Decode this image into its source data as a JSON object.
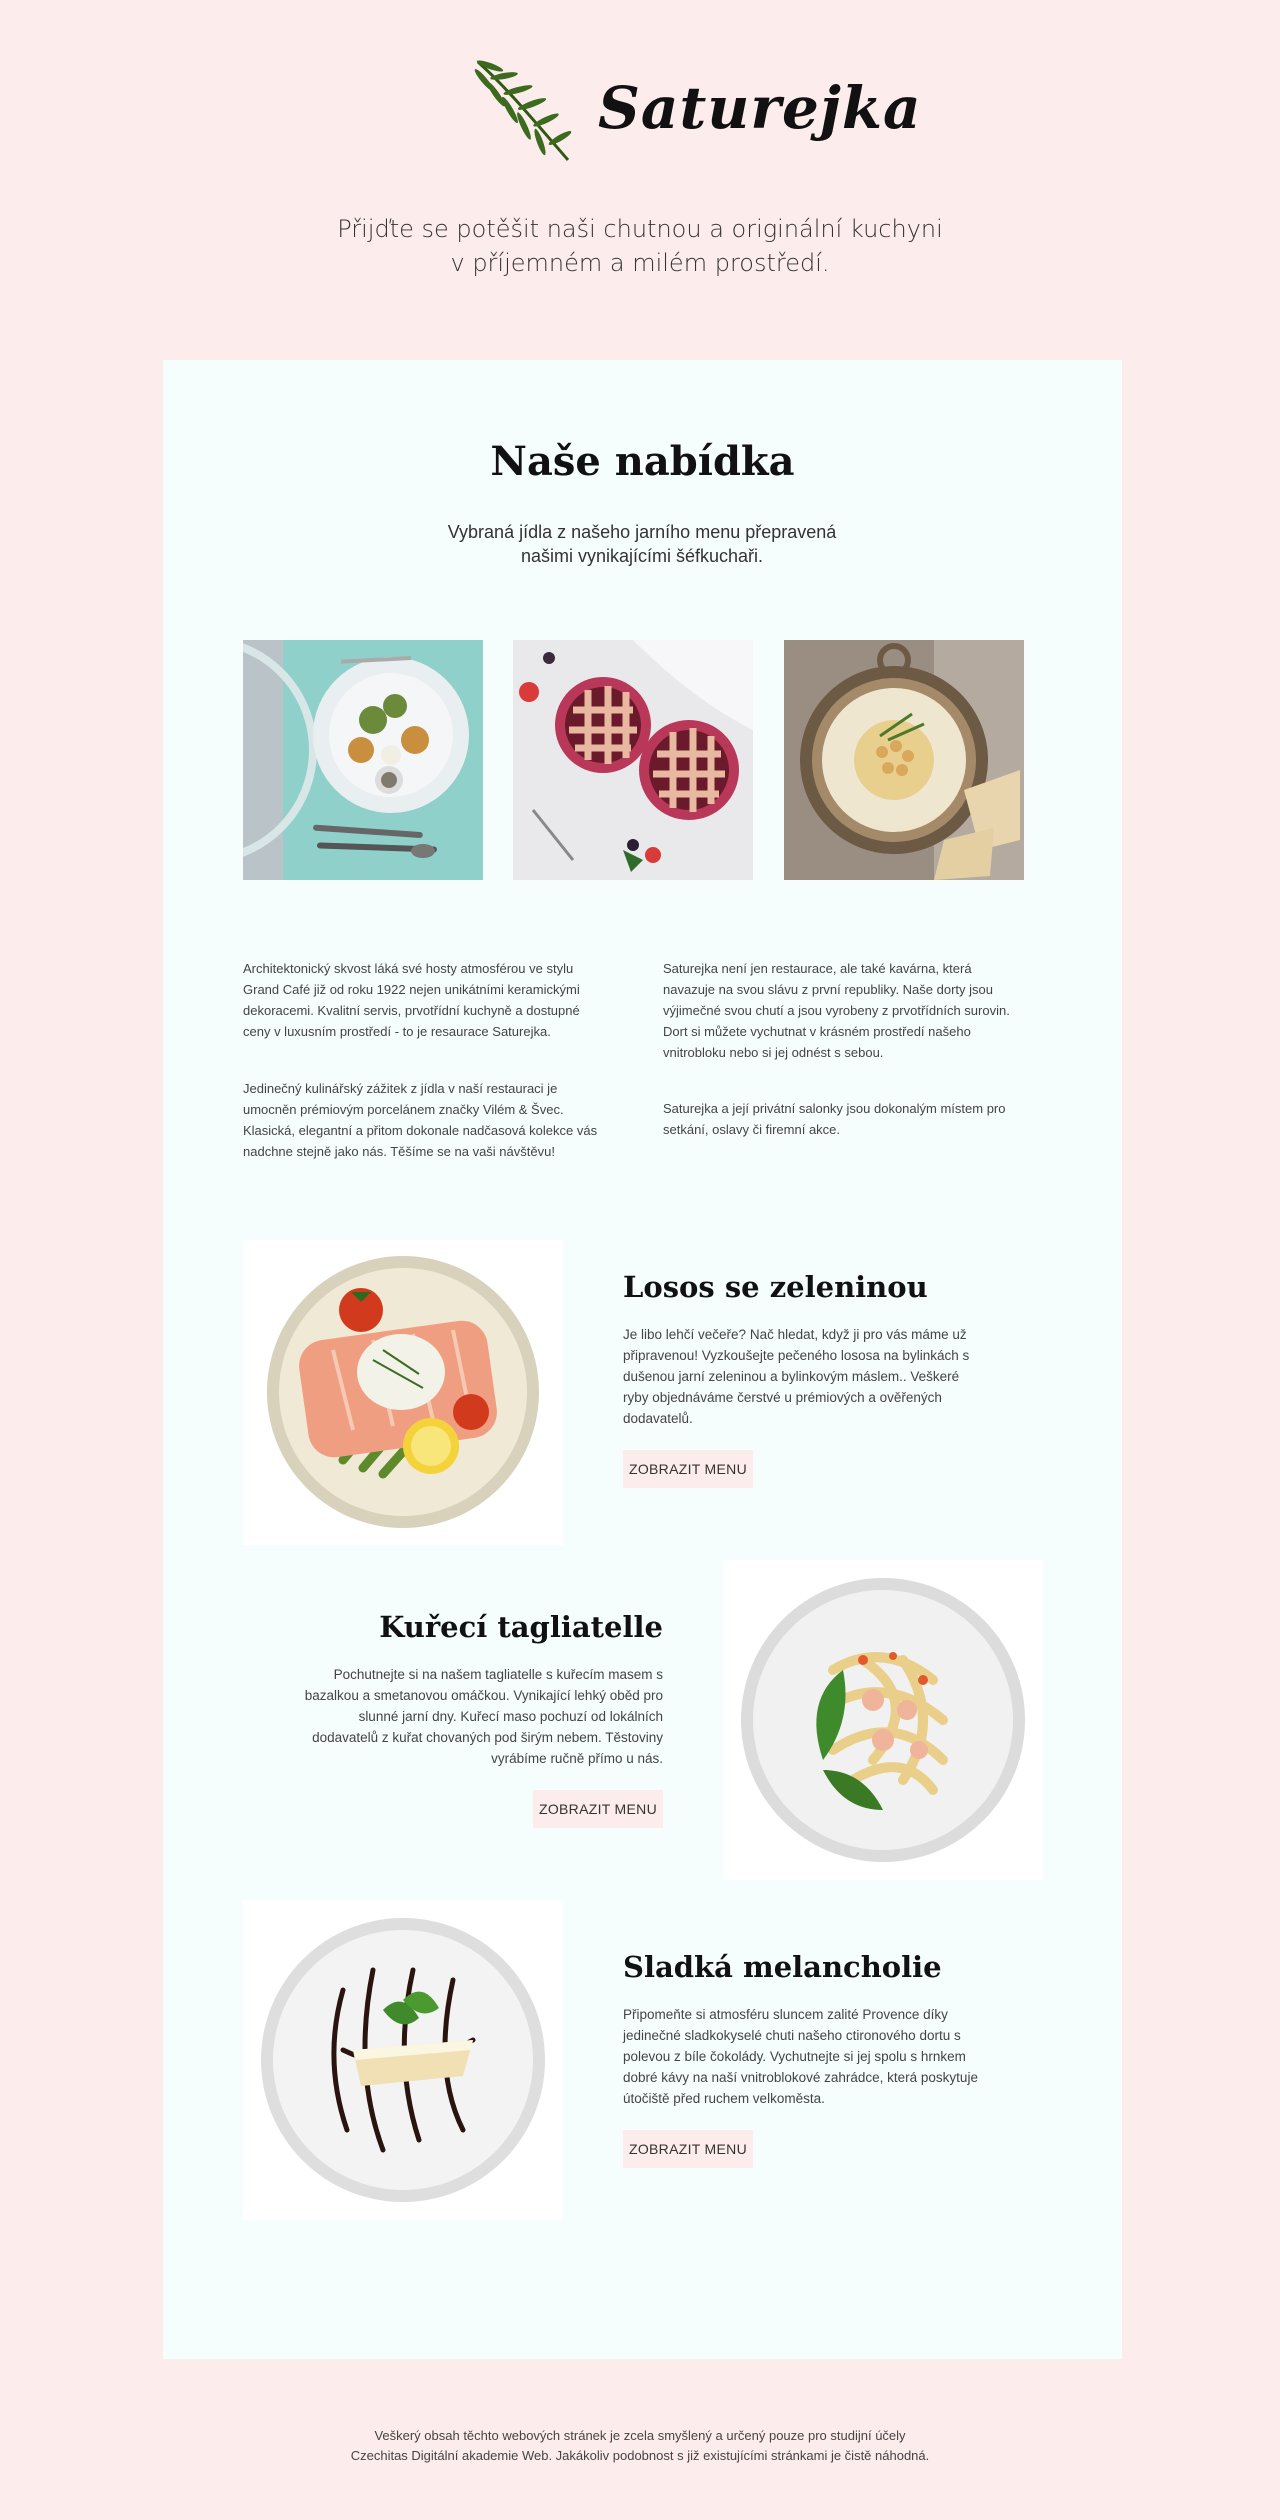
{
  "header": {
    "logo_text": "Saturejka",
    "tagline_line1": "Přijďte se potěšit naši chutnou a originální kuchyni",
    "tagline_line2": "v příjemném a milém prostředí."
  },
  "menu_section": {
    "title": "Naše nabídka",
    "subtitle_line1": "Vybraná jídla z našeho jarního menu přepravená",
    "subtitle_line2": "našimi vynikajícími šéfkuchaři."
  },
  "gallery": [
    {
      "icon": "salad-plate-photo"
    },
    {
      "icon": "berry-pie-photo"
    },
    {
      "icon": "hummus-bowl-photo"
    }
  ],
  "about": {
    "left_p1": "Architektonický skvost láká své hosty atmosférou ve stylu Grand Café již od roku 1922 nejen unikátními keramickými dekoracemi. Kvalitní servis, prvotřídní kuchyně a dostupné ceny v luxusním prostředí - to je resaurace Saturejka.",
    "left_p2": "Jedinečný kulinářský zážitek z jídla v naší restauraci je umocněn prémiovým porcelánem značky Vilém & Švec. Klasická, elegantní a přitom dokonale nadčasová kolekce vás nadchne stejně jako nás. Těšíme se na vaši návštěvu!",
    "right_p1": "Saturejka není jen restaurace, ale také kavárna, která navazuje na svou slávu z první republiky. Naše dorty jsou výjimečné svou chutí a jsou vyrobeny z prvotřídních surovin. Dort si můžete vychutnat v krásném prostředí našeho vnitrobloku nebo si jej odnést s sebou.",
    "right_p2": "Saturejka a její privátní salonky jsou dokonalým místem pro setkání, oslavy či firemní akce."
  },
  "dishes": [
    {
      "title": "Losos se zeleninou",
      "description": "Je libo lehčí večeře? Nač hledat, když ji pro vás máme už připravenou! Vyzkoušejte pečeného lososa na bylinkách s dušenou jarní zeleninou a bylinkovým máslem.. Veškeré ryby objednáváme čerstvé u prémiových a ověřených dodavatelů.",
      "button": "ZOBRAZIT MENU"
    },
    {
      "title": "Kuřecí tagliatelle",
      "description": "Pochutnejte si na našem tagliatelle s kuřecím masem s bazalkou a smetanovou omáčkou. Vynikající lehký oběd pro slunné jarní dny. Kuřecí maso pochuzí od lokálních dodavatelů z kuřat chovaných pod širým nebem. Těstoviny vyrábíme ručně přímo u nás.",
      "button": "ZOBRAZIT MENU"
    },
    {
      "title": "Sladká melancholie",
      "description": "Připomeňte si atmosféru sluncem zalité Provence díky jedinečné sladkokyselé chuti našeho ctironového dortu s polevou z bíle čokolády. Vychutnejte si jej spolu s hrnkem dobré kávy na naší vnitroblokové zahrádce, která poskytuje útočiště před ruchem velkoměsta.",
      "button": "ZOBRAZIT MENU"
    }
  ],
  "footer": {
    "line1": "Veškerý obsah těchto webových stránek je zcela smyšlený a určený pouze pro studijní účely",
    "line2": "Czechitas Digitální akademie Web. Jakákoliv podobnost s již existujícími stránkami je čistě náhodná."
  },
  "colors": {
    "page_background": "#fdecec",
    "card_background": "#f5fdfd",
    "button_background": "#fdecec",
    "logo_green": "#3c6a1e"
  }
}
